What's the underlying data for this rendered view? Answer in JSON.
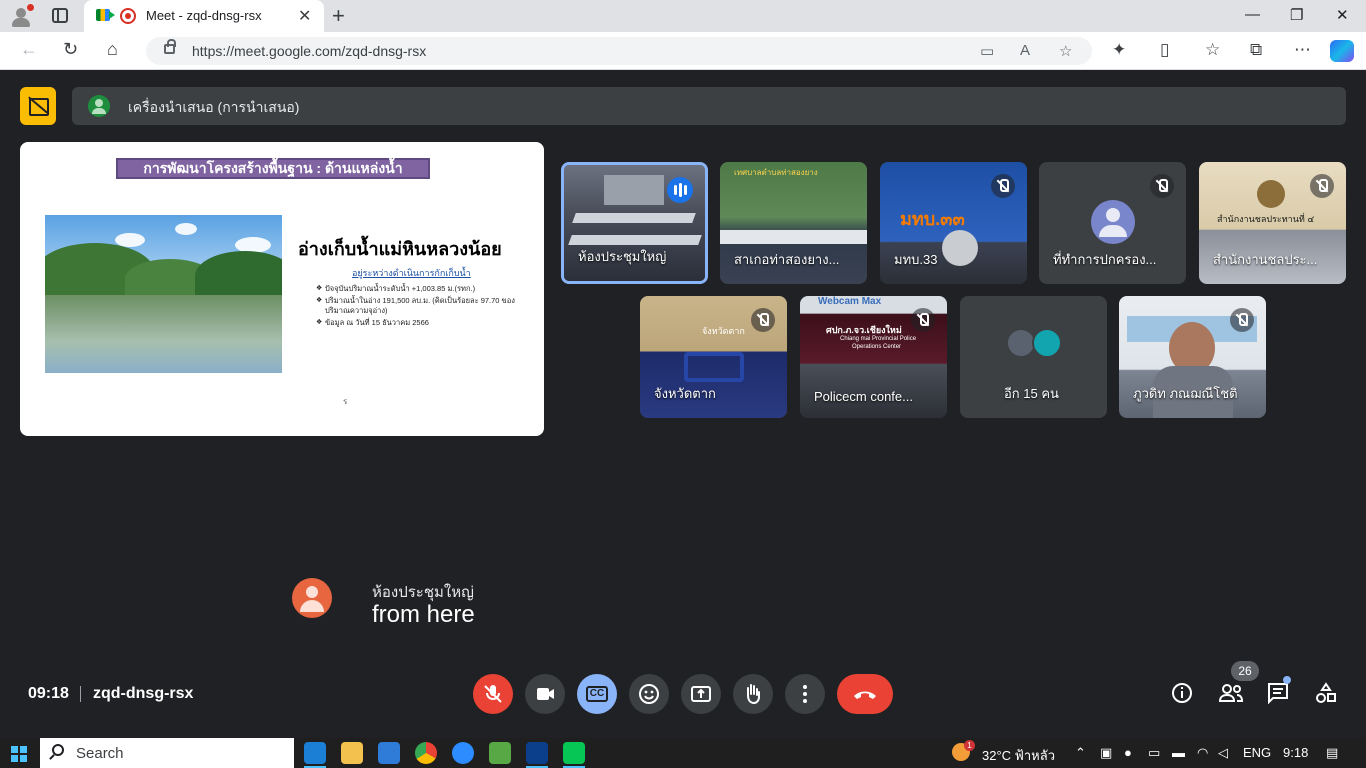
{
  "browser": {
    "tab_title": "Meet - zqd-dnsg-rsx",
    "url": "https://meet.google.com/zqd-dnsg-rsx"
  },
  "meet": {
    "presenter_label": "เครื่องนำเสนอ (การนำเสนอ)",
    "slide": {
      "title": "การพัฒนาโครงสร้างพื้นฐาน :  ด้านแหล่งน้ำ",
      "heading": "อ่างเก็บน้ำแม่หินหลวงน้อย",
      "subheading": "อยู่ระหว่างดำเนินการกักเก็บน้ำ",
      "bullets": [
        "ปัจจุบันปริมาณน้ำระดับน้ำ +1,003.85 ม.(รทก.)",
        "ปริมาณน้ำในอ่าง  191,500 ลบ.ม. (คิดเป็นร้อยละ 97.70 ของปริมาณความจุอ่าง)",
        "ข้อมูล ณ  วันที่  15  ธันวาคม  2566"
      ],
      "mark": "ร"
    },
    "participants": [
      {
        "name": "ห้องประชุมใหญ่",
        "state": "speaking"
      },
      {
        "name": "สาเกอท่าสองยาง...",
        "state": "normal"
      },
      {
        "name": "มทบ.33",
        "state": "muted"
      },
      {
        "name": "ที่ทำการปกครอง...",
        "state": "muted"
      },
      {
        "name": "สำนักงานชลประ...",
        "state": "muted"
      },
      {
        "name": "จังหวัดตาก",
        "state": "muted"
      },
      {
        "name": "Policecm confe...",
        "state": "muted"
      },
      {
        "name": "อีก 15 คน",
        "state": "more"
      },
      {
        "name": "ภูวดิท ภณฌณีโชติ",
        "state": "muted"
      }
    ],
    "tile_texts": {
      "t2_banner": "เทศบาลตำบลท่าสองยาง",
      "t3_sign": "มทบ.๓๓",
      "t5_sign": "สำนักงานชลประทานที่ ๔",
      "t6_sign": "จังหวัดตาก",
      "t7_top": "Webcam Max",
      "t7_sign": "ศปก.ภ.จว.เชียงใหม่",
      "t7_sub1": "Chiang mai Provincial Police",
      "t7_sub2": "Operations Center"
    },
    "caption": {
      "speaker": "ห้องประชุมใหญ่",
      "text": "from here"
    },
    "time": "09:18",
    "meeting_code": "zqd-dnsg-rsx",
    "participant_count": "26"
  },
  "taskbar": {
    "search_placeholder": "Search",
    "weather": "32°C ฟ้าหลัว",
    "weather_badge": "1",
    "lang": "ENG",
    "clock": "9:18"
  },
  "colors": {
    "accent": "#8ab4f8",
    "end_call": "#ea4335",
    "present": "#fbbc04"
  }
}
